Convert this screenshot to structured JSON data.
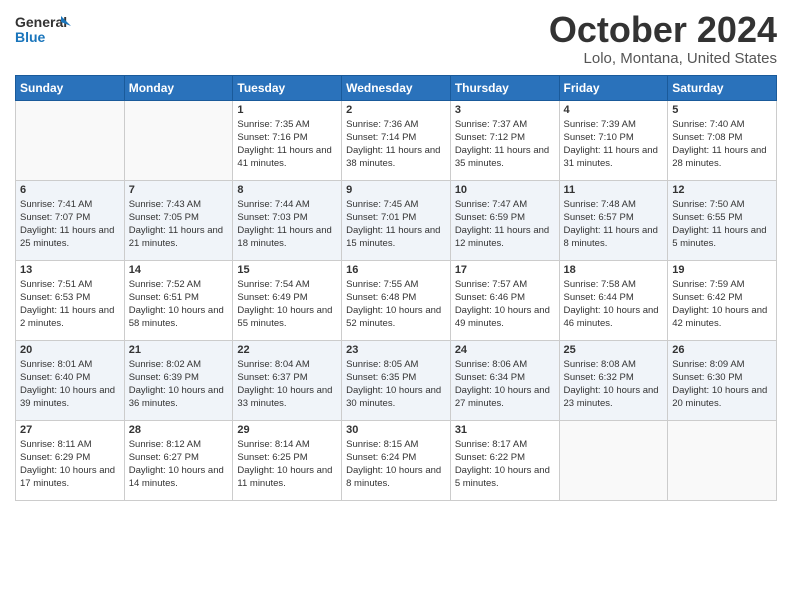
{
  "header": {
    "logo_line1": "General",
    "logo_line2": "Blue",
    "month_title": "October 2024",
    "location": "Lolo, Montana, United States"
  },
  "days_of_week": [
    "Sunday",
    "Monday",
    "Tuesday",
    "Wednesday",
    "Thursday",
    "Friday",
    "Saturday"
  ],
  "weeks": [
    [
      {
        "num": "",
        "info": ""
      },
      {
        "num": "",
        "info": ""
      },
      {
        "num": "1",
        "info": "Sunrise: 7:35 AM\nSunset: 7:16 PM\nDaylight: 11 hours and 41 minutes."
      },
      {
        "num": "2",
        "info": "Sunrise: 7:36 AM\nSunset: 7:14 PM\nDaylight: 11 hours and 38 minutes."
      },
      {
        "num": "3",
        "info": "Sunrise: 7:37 AM\nSunset: 7:12 PM\nDaylight: 11 hours and 35 minutes."
      },
      {
        "num": "4",
        "info": "Sunrise: 7:39 AM\nSunset: 7:10 PM\nDaylight: 11 hours and 31 minutes."
      },
      {
        "num": "5",
        "info": "Sunrise: 7:40 AM\nSunset: 7:08 PM\nDaylight: 11 hours and 28 minutes."
      }
    ],
    [
      {
        "num": "6",
        "info": "Sunrise: 7:41 AM\nSunset: 7:07 PM\nDaylight: 11 hours and 25 minutes."
      },
      {
        "num": "7",
        "info": "Sunrise: 7:43 AM\nSunset: 7:05 PM\nDaylight: 11 hours and 21 minutes."
      },
      {
        "num": "8",
        "info": "Sunrise: 7:44 AM\nSunset: 7:03 PM\nDaylight: 11 hours and 18 minutes."
      },
      {
        "num": "9",
        "info": "Sunrise: 7:45 AM\nSunset: 7:01 PM\nDaylight: 11 hours and 15 minutes."
      },
      {
        "num": "10",
        "info": "Sunrise: 7:47 AM\nSunset: 6:59 PM\nDaylight: 11 hours and 12 minutes."
      },
      {
        "num": "11",
        "info": "Sunrise: 7:48 AM\nSunset: 6:57 PM\nDaylight: 11 hours and 8 minutes."
      },
      {
        "num": "12",
        "info": "Sunrise: 7:50 AM\nSunset: 6:55 PM\nDaylight: 11 hours and 5 minutes."
      }
    ],
    [
      {
        "num": "13",
        "info": "Sunrise: 7:51 AM\nSunset: 6:53 PM\nDaylight: 11 hours and 2 minutes."
      },
      {
        "num": "14",
        "info": "Sunrise: 7:52 AM\nSunset: 6:51 PM\nDaylight: 10 hours and 58 minutes."
      },
      {
        "num": "15",
        "info": "Sunrise: 7:54 AM\nSunset: 6:49 PM\nDaylight: 10 hours and 55 minutes."
      },
      {
        "num": "16",
        "info": "Sunrise: 7:55 AM\nSunset: 6:48 PM\nDaylight: 10 hours and 52 minutes."
      },
      {
        "num": "17",
        "info": "Sunrise: 7:57 AM\nSunset: 6:46 PM\nDaylight: 10 hours and 49 minutes."
      },
      {
        "num": "18",
        "info": "Sunrise: 7:58 AM\nSunset: 6:44 PM\nDaylight: 10 hours and 46 minutes."
      },
      {
        "num": "19",
        "info": "Sunrise: 7:59 AM\nSunset: 6:42 PM\nDaylight: 10 hours and 42 minutes."
      }
    ],
    [
      {
        "num": "20",
        "info": "Sunrise: 8:01 AM\nSunset: 6:40 PM\nDaylight: 10 hours and 39 minutes."
      },
      {
        "num": "21",
        "info": "Sunrise: 8:02 AM\nSunset: 6:39 PM\nDaylight: 10 hours and 36 minutes."
      },
      {
        "num": "22",
        "info": "Sunrise: 8:04 AM\nSunset: 6:37 PM\nDaylight: 10 hours and 33 minutes."
      },
      {
        "num": "23",
        "info": "Sunrise: 8:05 AM\nSunset: 6:35 PM\nDaylight: 10 hours and 30 minutes."
      },
      {
        "num": "24",
        "info": "Sunrise: 8:06 AM\nSunset: 6:34 PM\nDaylight: 10 hours and 27 minutes."
      },
      {
        "num": "25",
        "info": "Sunrise: 8:08 AM\nSunset: 6:32 PM\nDaylight: 10 hours and 23 minutes."
      },
      {
        "num": "26",
        "info": "Sunrise: 8:09 AM\nSunset: 6:30 PM\nDaylight: 10 hours and 20 minutes."
      }
    ],
    [
      {
        "num": "27",
        "info": "Sunrise: 8:11 AM\nSunset: 6:29 PM\nDaylight: 10 hours and 17 minutes."
      },
      {
        "num": "28",
        "info": "Sunrise: 8:12 AM\nSunset: 6:27 PM\nDaylight: 10 hours and 14 minutes."
      },
      {
        "num": "29",
        "info": "Sunrise: 8:14 AM\nSunset: 6:25 PM\nDaylight: 10 hours and 11 minutes."
      },
      {
        "num": "30",
        "info": "Sunrise: 8:15 AM\nSunset: 6:24 PM\nDaylight: 10 hours and 8 minutes."
      },
      {
        "num": "31",
        "info": "Sunrise: 8:17 AM\nSunset: 6:22 PM\nDaylight: 10 hours and 5 minutes."
      },
      {
        "num": "",
        "info": ""
      },
      {
        "num": "",
        "info": ""
      }
    ]
  ]
}
